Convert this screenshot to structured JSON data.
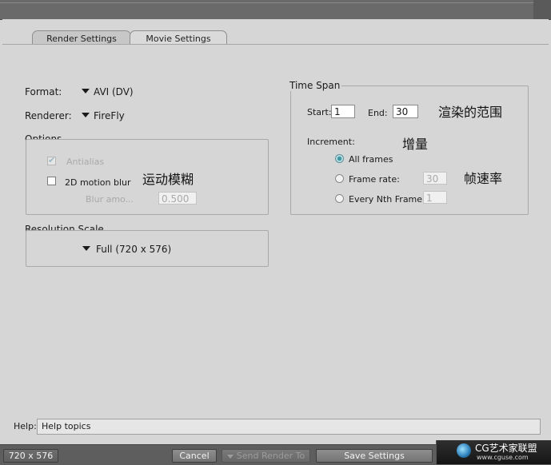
{
  "tabs": [
    {
      "label": "Render Settings"
    },
    {
      "label": "Movie Settings"
    }
  ],
  "format": {
    "label": "Format:",
    "value": "AVI (DV)"
  },
  "renderer": {
    "label": "Renderer:",
    "value": "FireFly"
  },
  "options": {
    "title": "Options",
    "antialias_label": "Antialias",
    "motion_blur_label": "2D motion blur",
    "blur_amount_label": "Blur amo...",
    "blur_amount_value": "0.500"
  },
  "resolution": {
    "title": "Resolution Scale",
    "value": "Full (720 x 576)"
  },
  "time_span": {
    "title": "Time Span",
    "start_label": "Start:",
    "start_value": "1",
    "end_label": "End:",
    "end_value": "30",
    "increment_label": "Increment:",
    "all_frames_label": "All frames",
    "frame_rate_label": "Frame rate:",
    "frame_rate_value": "30",
    "every_nth_label": "Every Nth Frame:",
    "every_nth_value": "1"
  },
  "annotations": {
    "render_range": "渲染的范围",
    "increment": "增量",
    "frame_rate": "帧速率",
    "motion_blur": "运动模糊"
  },
  "help": {
    "label": "Help:",
    "value": "Help topics"
  },
  "bottom": {
    "size": "720 x 576",
    "cancel": "Cancel",
    "send_render_to": "Send Render To",
    "save_settings": "Save Settings"
  },
  "watermark": {
    "text": "CG艺术家联盟",
    "url": "www.cguse.com"
  },
  "colors": {
    "radio_accent": "#3f97a4",
    "bottom_bar": "#5e5e5e",
    "panel": "#d6d6d6"
  }
}
